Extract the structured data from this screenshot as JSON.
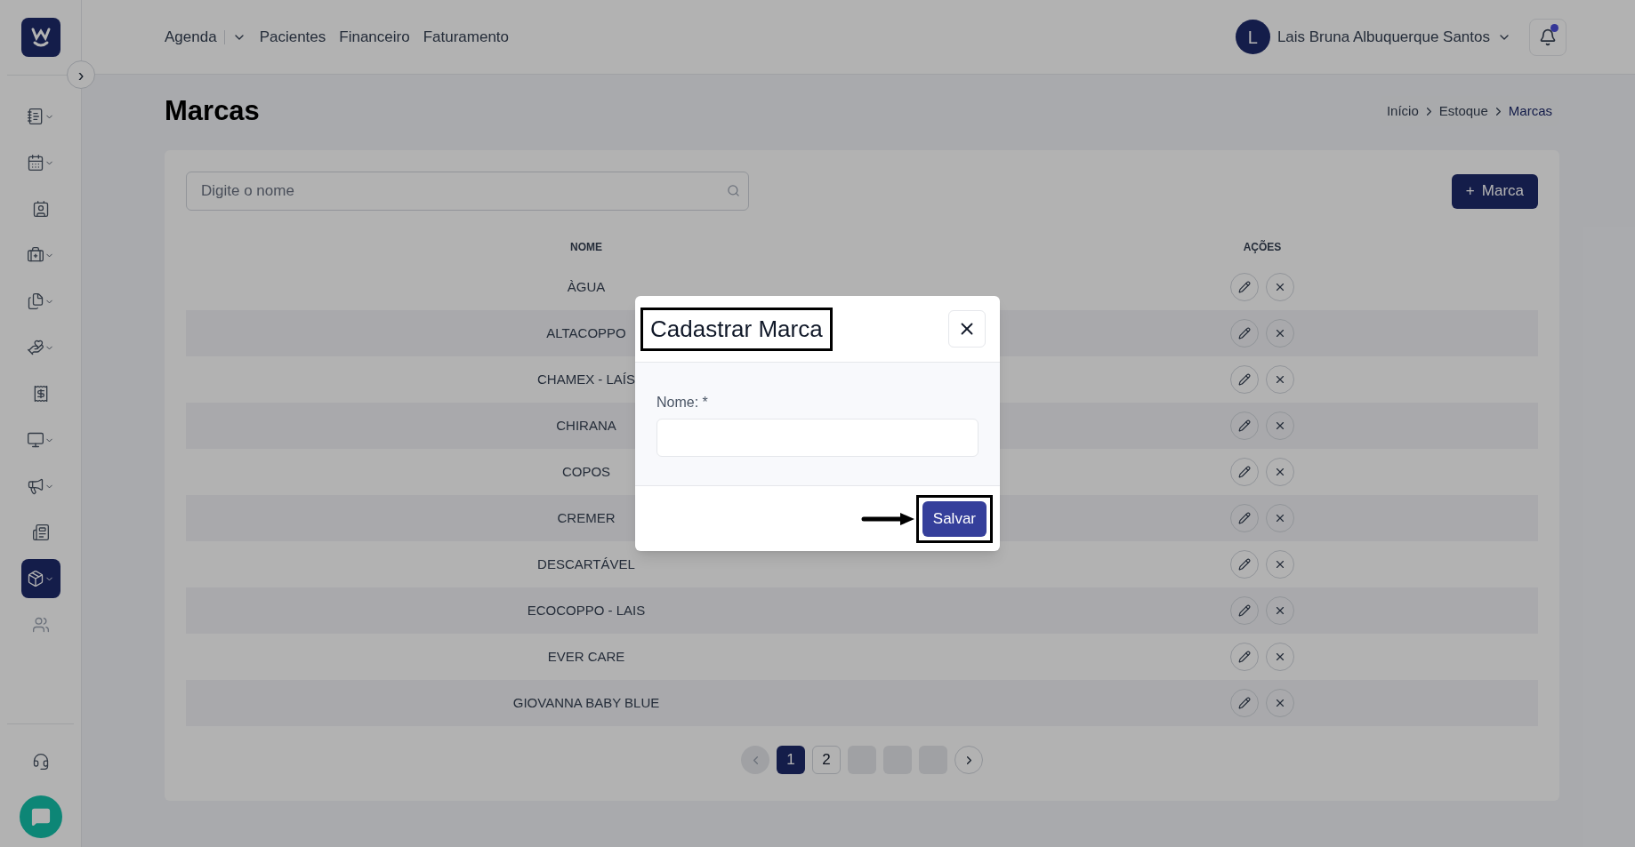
{
  "sidebar": {
    "collapse_button": "›",
    "items": [
      {
        "selected": false,
        "expandable": true
      },
      {
        "selected": false,
        "expandable": true
      },
      {
        "selected": false,
        "expandable": false
      },
      {
        "selected": false,
        "expandable": true
      },
      {
        "selected": false,
        "expandable": true
      },
      {
        "selected": false,
        "expandable": true
      },
      {
        "selected": false,
        "expandable": false
      },
      {
        "selected": false,
        "expandable": true
      },
      {
        "selected": false,
        "expandable": true
      },
      {
        "selected": false,
        "expandable": false
      },
      {
        "selected": true,
        "expandable": true
      },
      {
        "selected": false,
        "expandable": false
      }
    ]
  },
  "top_nav": {
    "items": [
      {
        "label": "Agenda",
        "dropdown": true
      },
      {
        "label": "Pacientes",
        "dropdown": false
      },
      {
        "label": "Financeiro",
        "dropdown": false
      },
      {
        "label": "Faturamento",
        "dropdown": false
      }
    ],
    "user": {
      "initial": "L",
      "name": "Lais Bruna Albuquerque Santos"
    },
    "notifications": {
      "unread": true
    }
  },
  "page": {
    "title": "Marcas",
    "breadcrumb": [
      {
        "label": "Início",
        "current": false
      },
      {
        "label": "Estoque",
        "current": false
      },
      {
        "label": "Marcas",
        "current": true
      }
    ]
  },
  "search": {
    "placeholder": "Digite o nome"
  },
  "add_button": {
    "icon": "+",
    "label": "Marca"
  },
  "table": {
    "columns": [
      "NOME",
      "AÇÕES"
    ],
    "rows": [
      {
        "name": "ÀGUA"
      },
      {
        "name": "ALTACOPPO"
      },
      {
        "name": "CHAMEX - LAÍS"
      },
      {
        "name": "CHIRANA"
      },
      {
        "name": "COPOS"
      },
      {
        "name": "CREMER"
      },
      {
        "name": "DESCARTÁVEL"
      },
      {
        "name": "ECOCOPPO - LAIS"
      },
      {
        "name": "EVER CARE"
      },
      {
        "name": "GIOVANNA BABY BLUE"
      }
    ]
  },
  "pagination": {
    "prev_disabled": true,
    "items": [
      {
        "kind": "page",
        "label": "1",
        "selected": true
      },
      {
        "kind": "page",
        "label": "2",
        "selected": false
      },
      {
        "kind": "blank"
      },
      {
        "kind": "blank"
      },
      {
        "kind": "blank"
      }
    ]
  },
  "modal": {
    "title": "Cadastrar Marca",
    "title_highlighted": true,
    "field_label": "Nome: *",
    "save_button": "Salvar",
    "save_highlighted": true,
    "arrow_to_save": true
  }
}
